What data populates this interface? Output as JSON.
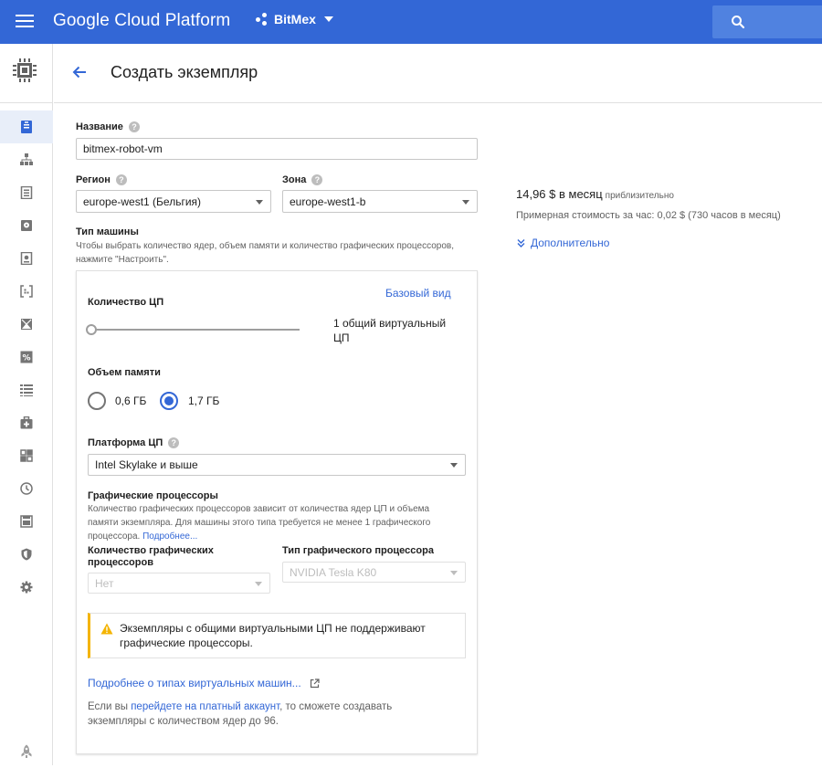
{
  "header": {
    "brand": "Google Cloud Platform",
    "project": "BitMex"
  },
  "page": {
    "title": "Создать экземпляр"
  },
  "form": {
    "name_label": "Название",
    "name_value": "bitmex-robot-vm",
    "region_label": "Регион",
    "region_value": "europe-west1 (Бельгия)",
    "zone_label": "Зона",
    "zone_value": "europe-west1-b",
    "machine_type_label": "Тип машины",
    "machine_type_hint": "Чтобы выбрать количество ядер, объем памяти и количество графических процессоров, нажмите \"Настроить\"."
  },
  "machine": {
    "basic_view": "Базовый вид",
    "cpu_label": "Количество ЦП",
    "cpu_value": "1 общий виртуальный ЦП",
    "cpu_slider_level": 0,
    "memory_label": "Объем памяти",
    "memory_options": [
      "0,6 ГБ",
      "1,7 ГБ"
    ],
    "memory_selected": "1,7 ГБ",
    "platform_label": "Платформа ЦП",
    "platform_value": "Intel Skylake и выше",
    "gpu_title": "Графические процессоры",
    "gpu_hint": "Количество графических процессоров зависит от количества ядер ЦП и объема памяти экземпляра. Для машины этого типа требуется не менее 1 графического процессора.",
    "gpu_hint_link": "Подробнее...",
    "gpu_count_label": "Количество графических процессоров",
    "gpu_count_value": "Нет",
    "gpu_type_label": "Тип графического процессора",
    "gpu_type_value": "NVIDIA Tesla K80",
    "warning": "Экземпляры с общими виртуальными ЦП не поддерживают графические процессоры.",
    "learn_more": "Подробнее о типах виртуальных машин...",
    "billing_pre": "Если вы ",
    "billing_link": "перейдете на платный аккаунт",
    "billing_post": ", то сможете создавать экземпляры с количеством ядер до 96."
  },
  "pricing": {
    "monthly": "14,96 $ в месяц",
    "approx": "приблизительно",
    "hourly": "Примерная стоимость за час: 0,02 $ (730 часов в месяц)",
    "more": "Дополнительно"
  },
  "colors": {
    "topbar": "#3367d6",
    "accent": "#3367d6",
    "warning": "#f4b400"
  },
  "rail_icons": [
    "compute-engine-icon",
    "vm-instances-icon",
    "instance-groups-icon",
    "instance-templates-icon",
    "disks-icon",
    "snapshots-icon",
    "images-icon",
    "tpus-icon",
    "committed-use-icon",
    "metadata-icon",
    "health-checks-icon",
    "zones-icon",
    "operations-icon",
    "quotas-icon",
    "security-scans-icon",
    "settings-icon",
    "marketplace-icon"
  ]
}
